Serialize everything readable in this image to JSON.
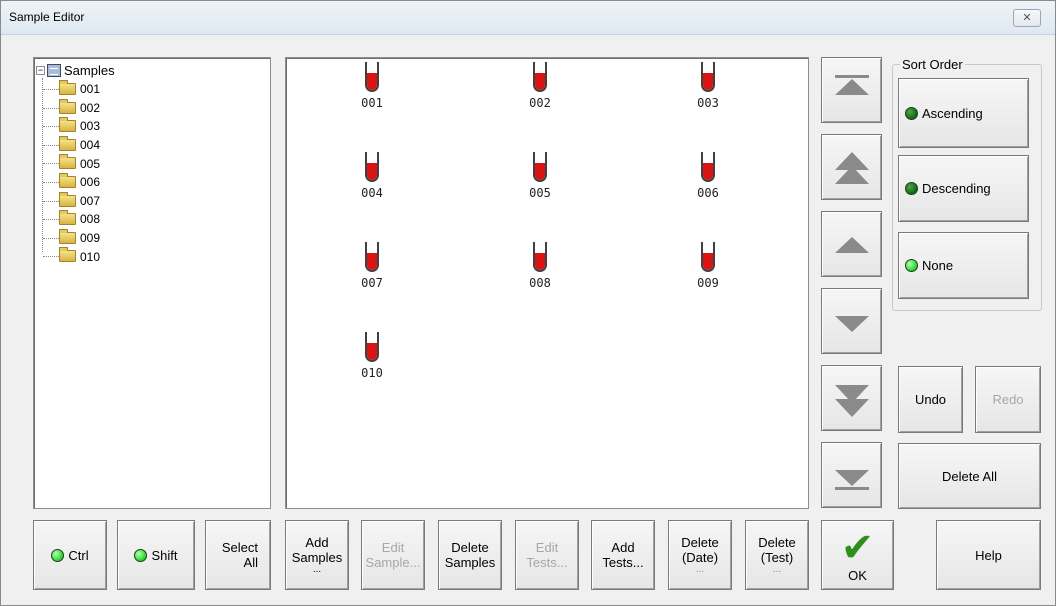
{
  "window": {
    "title": "Sample Editor",
    "close_glyph": "✕"
  },
  "tree": {
    "root_label": "Samples",
    "items": [
      "001",
      "002",
      "003",
      "004",
      "005",
      "006",
      "007",
      "008",
      "009",
      "010"
    ]
  },
  "samples": [
    "001",
    "002",
    "003",
    "004",
    "005",
    "006",
    "007",
    "008",
    "009",
    "010"
  ],
  "sort_order": {
    "legend": "Sort Order",
    "options": [
      "Ascending",
      "Descending",
      "None"
    ]
  },
  "arrows": [
    "move-to-top-icon",
    "move-up-page-icon",
    "move-up-icon",
    "move-down-icon",
    "move-down-page-icon",
    "move-to-bottom-icon"
  ],
  "side_buttons": {
    "undo": "Undo",
    "redo": "Redo",
    "delete_all": "Delete All"
  },
  "bottom": {
    "ctrl": "Ctrl",
    "shift": "Shift",
    "select_all": [
      "Select",
      "All"
    ],
    "add_samples": [
      "Add",
      "Samples",
      "..."
    ],
    "edit_sample": [
      "Edit",
      "Sample..."
    ],
    "delete_samples": [
      "Delete",
      "Samples"
    ],
    "edit_tests": [
      "Edit",
      "Tests..."
    ],
    "add_tests": [
      "Add",
      "Tests..."
    ],
    "delete_date": [
      "Delete",
      "(Date)",
      "..."
    ],
    "delete_test": [
      "Delete",
      "(Test)",
      "..."
    ],
    "ok": "OK",
    "help": "Help"
  },
  "colors": {
    "tube_fill": "#d81414",
    "led_dark": "#177117",
    "led_bright": "#33dd33",
    "checkmark": "#2f8f1c"
  }
}
